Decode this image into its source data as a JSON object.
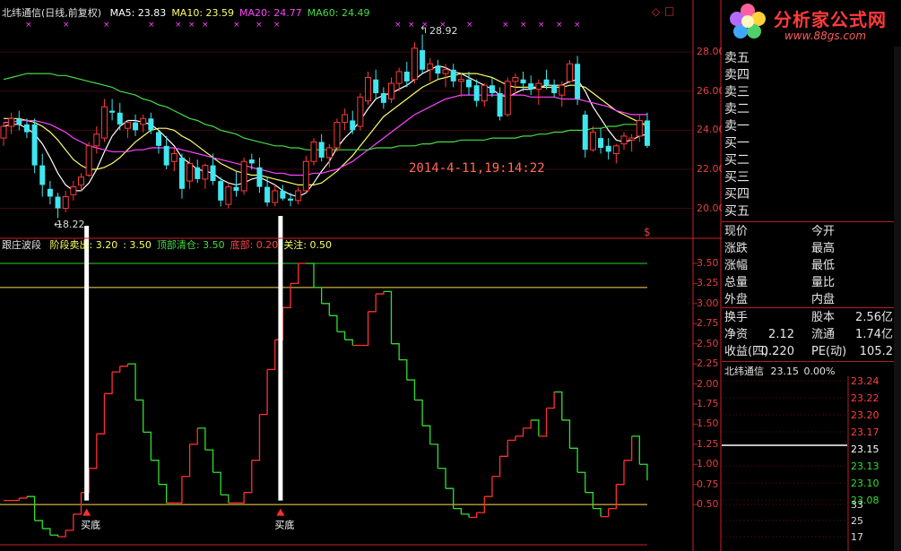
{
  "header": {
    "title": "北纬通信(日线,前复权)",
    "ma": [
      {
        "label": "MA5: 23.83",
        "color": "#ffffff"
      },
      {
        "label": "MA10: 23.59",
        "color": "#ffff66"
      },
      {
        "label": "MA20: 24.77",
        "color": "#ff44ff"
      },
      {
        "label": "MA60: 24.49",
        "color": "#44dd44"
      }
    ]
  },
  "indicator": {
    "name": "跟庄波段",
    "items": [
      {
        "label": "阶段卖出: 3.20",
        "color": "#ffff66"
      },
      {
        "label": ": 3.50",
        "color": "#ffff66"
      },
      {
        "label": "顶部清仓: 3.50",
        "color": "#44dd44"
      },
      {
        "label": "底部: 0.20",
        "color": "#ff4444"
      },
      {
        "label": "关注: 0.50",
        "color": "#ffff66"
      }
    ],
    "buy_label": "买底"
  },
  "annotations": {
    "datetime": "2014-4-11,19:14:22",
    "high": "28.92",
    "low": "18.22",
    "sell_mark": "$",
    "diamond": "◇",
    "box": "□"
  },
  "logo": {
    "title": "分析家公式网",
    "url": "www.88gs.com"
  },
  "order_book": {
    "sell": [
      "卖五",
      "卖四",
      "卖三",
      "卖二",
      "卖一"
    ],
    "buy": [
      "买一",
      "买二",
      "买三",
      "买四",
      "买五"
    ]
  },
  "quote": {
    "rows": [
      {
        "l1": "现价",
        "v1": "",
        "l2": "今开",
        "v2": ""
      },
      {
        "l1": "涨跌",
        "v1": "",
        "l2": "最高",
        "v2": ""
      },
      {
        "l1": "涨幅",
        "v1": "",
        "l2": "最低",
        "v2": ""
      },
      {
        "l1": "总量",
        "v1": "",
        "l2": "量比",
        "v2": ""
      },
      {
        "l1": "外盘",
        "v1": "",
        "l2": "内盘",
        "v2": ""
      }
    ],
    "rows2": [
      {
        "l1": "换手",
        "v1": "",
        "l2": "股本",
        "v2": "2.56亿"
      },
      {
        "l1": "净资",
        "v1": "2.12",
        "l2": "流通",
        "v2": "1.74亿"
      },
      {
        "l1": "收益(四)",
        "v1": "0.220",
        "l2": "PE(动)",
        "v2": "105.2"
      }
    ]
  },
  "mini": {
    "name": "北纬通信",
    "price": "23.15",
    "change": "0.00%",
    "right_ticks": [
      "23.24",
      "23.22",
      "23.20",
      "23.17",
      "23.15",
      "23.13",
      "23.10",
      "23.08",
      "33",
      "25",
      "17"
    ]
  },
  "chart_data": [
    {
      "type": "candlestick",
      "title": "北纬通信(日线,前复权)",
      "ylim": [
        19.2,
        29.2
      ],
      "yticks": [
        20.0,
        22.0,
        24.0,
        26.0,
        28.0
      ],
      "ytick_labels": [
        "20.00",
        "22.00",
        "24.00",
        "26.00",
        "28.00"
      ],
      "candles": [
        [
          23.6,
          24.4,
          23.2,
          24.2
        ],
        [
          24.2,
          24.9,
          23.8,
          24.6
        ],
        [
          24.6,
          25.0,
          24.0,
          24.3
        ],
        [
          24.3,
          24.6,
          23.6,
          23.9
        ],
        [
          24.3,
          24.6,
          21.8,
          22.2
        ],
        [
          22.2,
          22.8,
          20.6,
          21.2
        ],
        [
          21.0,
          21.4,
          20.2,
          20.6
        ],
        [
          20.6,
          20.8,
          19.5,
          20.0
        ],
        [
          20.0,
          20.9,
          19.8,
          20.6
        ],
        [
          20.7,
          21.4,
          20.4,
          21.1
        ],
        [
          21.2,
          21.8,
          20.9,
          21.6
        ],
        [
          21.7,
          23.4,
          21.6,
          23.2
        ],
        [
          23.2,
          24.2,
          22.8,
          23.8
        ],
        [
          23.6,
          25.6,
          23.4,
          25.2
        ],
        [
          25.0,
          25.6,
          24.5,
          24.9
        ],
        [
          24.9,
          25.4,
          24.0,
          24.3
        ],
        [
          24.1,
          24.5,
          23.6,
          24.4
        ],
        [
          24.4,
          24.8,
          23.7,
          24.0
        ],
        [
          24.3,
          24.8,
          23.9,
          24.6
        ],
        [
          24.6,
          24.9,
          23.8,
          24.0
        ],
        [
          23.9,
          24.0,
          22.8,
          23.2
        ],
        [
          23.2,
          23.7,
          22.0,
          22.2
        ],
        [
          22.4,
          23.1,
          21.9,
          22.8
        ],
        [
          22.6,
          22.8,
          20.5,
          21.0
        ],
        [
          21.4,
          22.6,
          21.0,
          22.3
        ],
        [
          22.1,
          22.5,
          21.3,
          21.5
        ],
        [
          21.5,
          22.3,
          21.0,
          22.2
        ],
        [
          22.2,
          22.8,
          21.2,
          21.4
        ],
        [
          21.4,
          21.6,
          20.1,
          20.4
        ],
        [
          20.2,
          21.3,
          20.0,
          21.1
        ],
        [
          21.1,
          21.9,
          20.6,
          20.9
        ],
        [
          20.9,
          22.6,
          20.7,
          22.4
        ],
        [
          22.5,
          22.8,
          22.0,
          22.3
        ],
        [
          22.1,
          22.6,
          20.8,
          21.1
        ],
        [
          21.1,
          21.6,
          20.1,
          20.3
        ],
        [
          20.3,
          21.2,
          20.1,
          20.9
        ],
        [
          20.9,
          21.2,
          20.4,
          20.5
        ],
        [
          20.5,
          20.8,
          20.1,
          20.4
        ],
        [
          20.4,
          21.1,
          20.2,
          20.9
        ],
        [
          20.9,
          22.7,
          20.8,
          22.4
        ],
        [
          22.4,
          23.6,
          22.2,
          23.4
        ],
        [
          23.4,
          23.8,
          22.4,
          22.6
        ],
        [
          22.6,
          23.3,
          22.1,
          23.1
        ],
        [
          23.1,
          24.6,
          22.9,
          24.4
        ],
        [
          24.4,
          25.1,
          24.0,
          24.8
        ],
        [
          24.5,
          25.0,
          23.8,
          24.0
        ],
        [
          24.2,
          25.9,
          24.0,
          25.7
        ],
        [
          25.5,
          27.0,
          25.3,
          26.7
        ],
        [
          26.6,
          27.1,
          25.6,
          25.9
        ],
        [
          25.9,
          26.2,
          25.1,
          25.4
        ],
        [
          25.6,
          26.7,
          25.4,
          26.4
        ],
        [
          26.4,
          27.2,
          26.0,
          27.0
        ],
        [
          27.0,
          27.5,
          26.2,
          26.5
        ],
        [
          26.6,
          28.5,
          26.4,
          28.2
        ],
        [
          28.1,
          28.9,
          26.9,
          27.1
        ],
        [
          27.1,
          27.7,
          26.5,
          27.4
        ],
        [
          27.3,
          27.6,
          26.6,
          26.9
        ],
        [
          26.9,
          27.4,
          26.2,
          27.1
        ],
        [
          27.1,
          27.4,
          26.2,
          26.5
        ],
        [
          26.5,
          26.9,
          25.7,
          26.6
        ],
        [
          26.6,
          27.0,
          25.8,
          26.2
        ],
        [
          26.3,
          26.6,
          25.2,
          25.5
        ],
        [
          25.5,
          26.4,
          25.2,
          26.3
        ],
        [
          26.3,
          26.7,
          25.7,
          25.9
        ],
        [
          25.9,
          26.2,
          24.5,
          24.7
        ],
        [
          24.8,
          26.7,
          24.7,
          26.5
        ],
        [
          26.5,
          26.9,
          25.8,
          26.7
        ],
        [
          26.6,
          27.0,
          26.0,
          26.4
        ],
        [
          26.4,
          26.8,
          25.8,
          26.1
        ],
        [
          26.1,
          26.6,
          25.3,
          26.4
        ],
        [
          26.6,
          27.1,
          26.1,
          26.3
        ],
        [
          26.3,
          26.6,
          25.7,
          25.9
        ],
        [
          25.8,
          26.5,
          25.2,
          26.3
        ],
        [
          26.5,
          27.6,
          26.4,
          27.4
        ],
        [
          27.4,
          27.8,
          25.3,
          25.6
        ],
        [
          24.8,
          25.0,
          22.6,
          23.0
        ],
        [
          23.0,
          24.2,
          22.9,
          23.9
        ],
        [
          23.6,
          24.1,
          22.8,
          23.1
        ],
        [
          23.2,
          23.6,
          22.5,
          22.9
        ],
        [
          22.8,
          23.3,
          22.3,
          23.2
        ],
        [
          23.3,
          23.9,
          23.0,
          23.7
        ],
        [
          23.5,
          23.8,
          22.9,
          23.6
        ],
        [
          23.7,
          24.8,
          23.4,
          24.5
        ],
        [
          24.5,
          24.9,
          23.1,
          23.2
        ]
      ],
      "series": [
        {
          "name": "MA5",
          "color": "#ffffff",
          "values": [
            24.2,
            24.3,
            24.3,
            24.1,
            23.8,
            23.3,
            22.6,
            21.8,
            21.2,
            20.9,
            20.9,
            21.3,
            22.0,
            22.9,
            23.7,
            24.2,
            24.5,
            24.5,
            24.4,
            24.3,
            24.0,
            23.6,
            23.2,
            22.6,
            22.3,
            22.0,
            21.9,
            21.8,
            21.5,
            21.3,
            21.2,
            21.3,
            21.5,
            21.6,
            21.4,
            21.2,
            20.9,
            20.7,
            20.6,
            20.8,
            21.3,
            21.9,
            22.4,
            23.1,
            23.6,
            24.0,
            24.5,
            25.1,
            25.6,
            25.8,
            25.9,
            26.1,
            26.3,
            26.6,
            26.9,
            27.1,
            27.3,
            27.2,
            27.0,
            26.9,
            26.7,
            26.5,
            26.3,
            26.1,
            25.8,
            25.7,
            25.9,
            26.1,
            26.1,
            26.2,
            26.3,
            26.3,
            26.3,
            26.5,
            26.6,
            26.0,
            25.2,
            24.6,
            24.0,
            23.5,
            23.4,
            23.5,
            23.7,
            23.8
          ],
          "style": "solid"
        },
        {
          "name": "MA10",
          "color": "#ffff66",
          "values": [
            24.6,
            24.6,
            24.6,
            24.5,
            24.4,
            24.2,
            23.9,
            23.5,
            23.0,
            22.5,
            22.2,
            22.0,
            22.0,
            22.1,
            22.3,
            22.6,
            23.0,
            23.4,
            23.7,
            24.0,
            24.1,
            24.1,
            24.0,
            23.7,
            23.5,
            23.2,
            22.9,
            22.6,
            22.3,
            22.1,
            21.9,
            21.8,
            21.7,
            21.7,
            21.6,
            21.5,
            21.4,
            21.3,
            21.2,
            21.2,
            21.2,
            21.3,
            21.6,
            21.9,
            22.3,
            22.7,
            23.2,
            23.7,
            24.2,
            24.7,
            25.0,
            25.3,
            25.6,
            25.9,
            26.2,
            26.4,
            26.6,
            26.7,
            26.8,
            26.9,
            26.9,
            26.9,
            26.8,
            26.7,
            26.5,
            26.3,
            26.2,
            26.2,
            26.2,
            26.2,
            26.2,
            26.2,
            26.2,
            26.3,
            26.3,
            26.2,
            25.9,
            25.6,
            25.3,
            25.0,
            24.8,
            24.6,
            24.4,
            24.2
          ],
          "style": "solid"
        },
        {
          "name": "MA20",
          "color": "#ff44ff",
          "values": [
            24.4,
            24.4,
            24.5,
            24.5,
            24.5,
            24.4,
            24.3,
            24.1,
            23.9,
            23.6,
            23.4,
            23.2,
            23.1,
            23.0,
            22.9,
            22.9,
            22.9,
            23.0,
            23.0,
            23.1,
            23.1,
            23.1,
            23.1,
            23.0,
            22.9,
            22.8,
            22.7,
            22.6,
            22.5,
            22.4,
            22.3,
            22.2,
            22.1,
            22.0,
            21.9,
            21.8,
            21.8,
            21.7,
            21.7,
            21.7,
            21.8,
            21.8,
            21.9,
            22.0,
            22.2,
            22.4,
            22.7,
            23.0,
            23.3,
            23.6,
            23.9,
            24.2,
            24.5,
            24.8,
            25.0,
            25.2,
            25.4,
            25.6,
            25.7,
            25.8,
            25.8,
            25.8,
            25.8,
            25.8,
            25.8,
            25.8,
            25.8,
            25.8,
            25.7,
            25.7,
            25.7,
            25.7,
            25.6,
            25.6,
            25.6,
            25.5,
            25.4,
            25.3,
            25.2,
            25.0,
            24.9,
            24.8,
            24.8,
            24.8
          ],
          "style": "solid"
        },
        {
          "name": "MA60",
          "color": "#44dd44",
          "values": [
            26.6,
            26.7,
            26.8,
            26.9,
            26.9,
            26.9,
            26.9,
            26.8,
            26.8,
            26.7,
            26.6,
            26.5,
            26.4,
            26.3,
            26.2,
            26.0,
            25.9,
            25.8,
            25.6,
            25.5,
            25.3,
            25.2,
            25.0,
            24.8,
            24.6,
            24.5,
            24.3,
            24.2,
            24.0,
            23.9,
            23.8,
            23.6,
            23.5,
            23.4,
            23.3,
            23.2,
            23.2,
            23.1,
            23.1,
            23.0,
            23.0,
            23.0,
            23.0,
            23.0,
            23.0,
            23.0,
            23.0,
            23.0,
            23.1,
            23.1,
            23.1,
            23.2,
            23.2,
            23.2,
            23.3,
            23.3,
            23.4,
            23.4,
            23.4,
            23.5,
            23.5,
            23.5,
            23.5,
            23.6,
            23.6,
            23.6,
            23.6,
            23.7,
            23.7,
            23.8,
            23.8,
            23.9,
            23.9,
            24.0,
            24.0,
            24.0,
            24.1,
            24.1,
            24.2,
            24.2,
            24.3,
            24.3,
            24.3,
            24.4
          ],
          "style": "solid"
        }
      ]
    },
    {
      "type": "line",
      "title": "跟庄波段",
      "ylim": [
        0.0,
        3.6
      ],
      "yticks": [
        0.5,
        0.75,
        1.0,
        1.25,
        1.5,
        1.75,
        2.0,
        2.25,
        2.5,
        2.75,
        3.0,
        3.25,
        3.5
      ],
      "ytick_labels": [
        "0.50",
        "0.75",
        "1.00",
        "1.25",
        "1.50",
        "1.75",
        "2.00",
        "2.25",
        "2.50",
        "2.75",
        "3.00",
        "3.25",
        "3.50"
      ],
      "hlines": [
        {
          "y": 3.5,
          "color": "#33cc33"
        },
        {
          "y": 3.2,
          "color": "#ffdd55"
        },
        {
          "y": 0.5,
          "color": "#ffdd55"
        },
        {
          "y": 0.0,
          "color": "#cc2222"
        }
      ],
      "series": [
        {
          "name": "波段",
          "values": [
            0.55,
            0.55,
            0.58,
            0.6,
            0.3,
            0.2,
            0.12,
            0.1,
            0.18,
            0.38,
            0.65,
            0.95,
            1.38,
            1.88,
            2.15,
            2.22,
            2.25,
            1.8,
            1.4,
            1.05,
            0.75,
            0.52,
            0.52,
            0.85,
            1.25,
            1.45,
            1.18,
            0.9,
            0.62,
            0.52,
            0.52,
            0.65,
            1.05,
            1.62,
            2.18,
            2.55,
            2.95,
            3.25,
            3.5,
            3.5,
            3.2,
            3.0,
            2.85,
            2.65,
            2.55,
            2.48,
            2.48,
            2.9,
            3.12,
            3.15,
            2.5,
            2.3,
            2.05,
            1.8,
            1.48,
            1.25,
            0.95,
            0.7,
            0.45,
            0.38,
            0.34,
            0.4,
            0.6,
            0.85,
            1.1,
            1.3,
            1.35,
            1.45,
            1.55,
            1.35,
            1.7,
            1.9,
            1.55,
            1.2,
            0.9,
            0.65,
            0.45,
            0.35,
            0.45,
            0.75,
            1.05,
            1.35,
            1.0,
            0.8
          ]
        }
      ]
    }
  ]
}
